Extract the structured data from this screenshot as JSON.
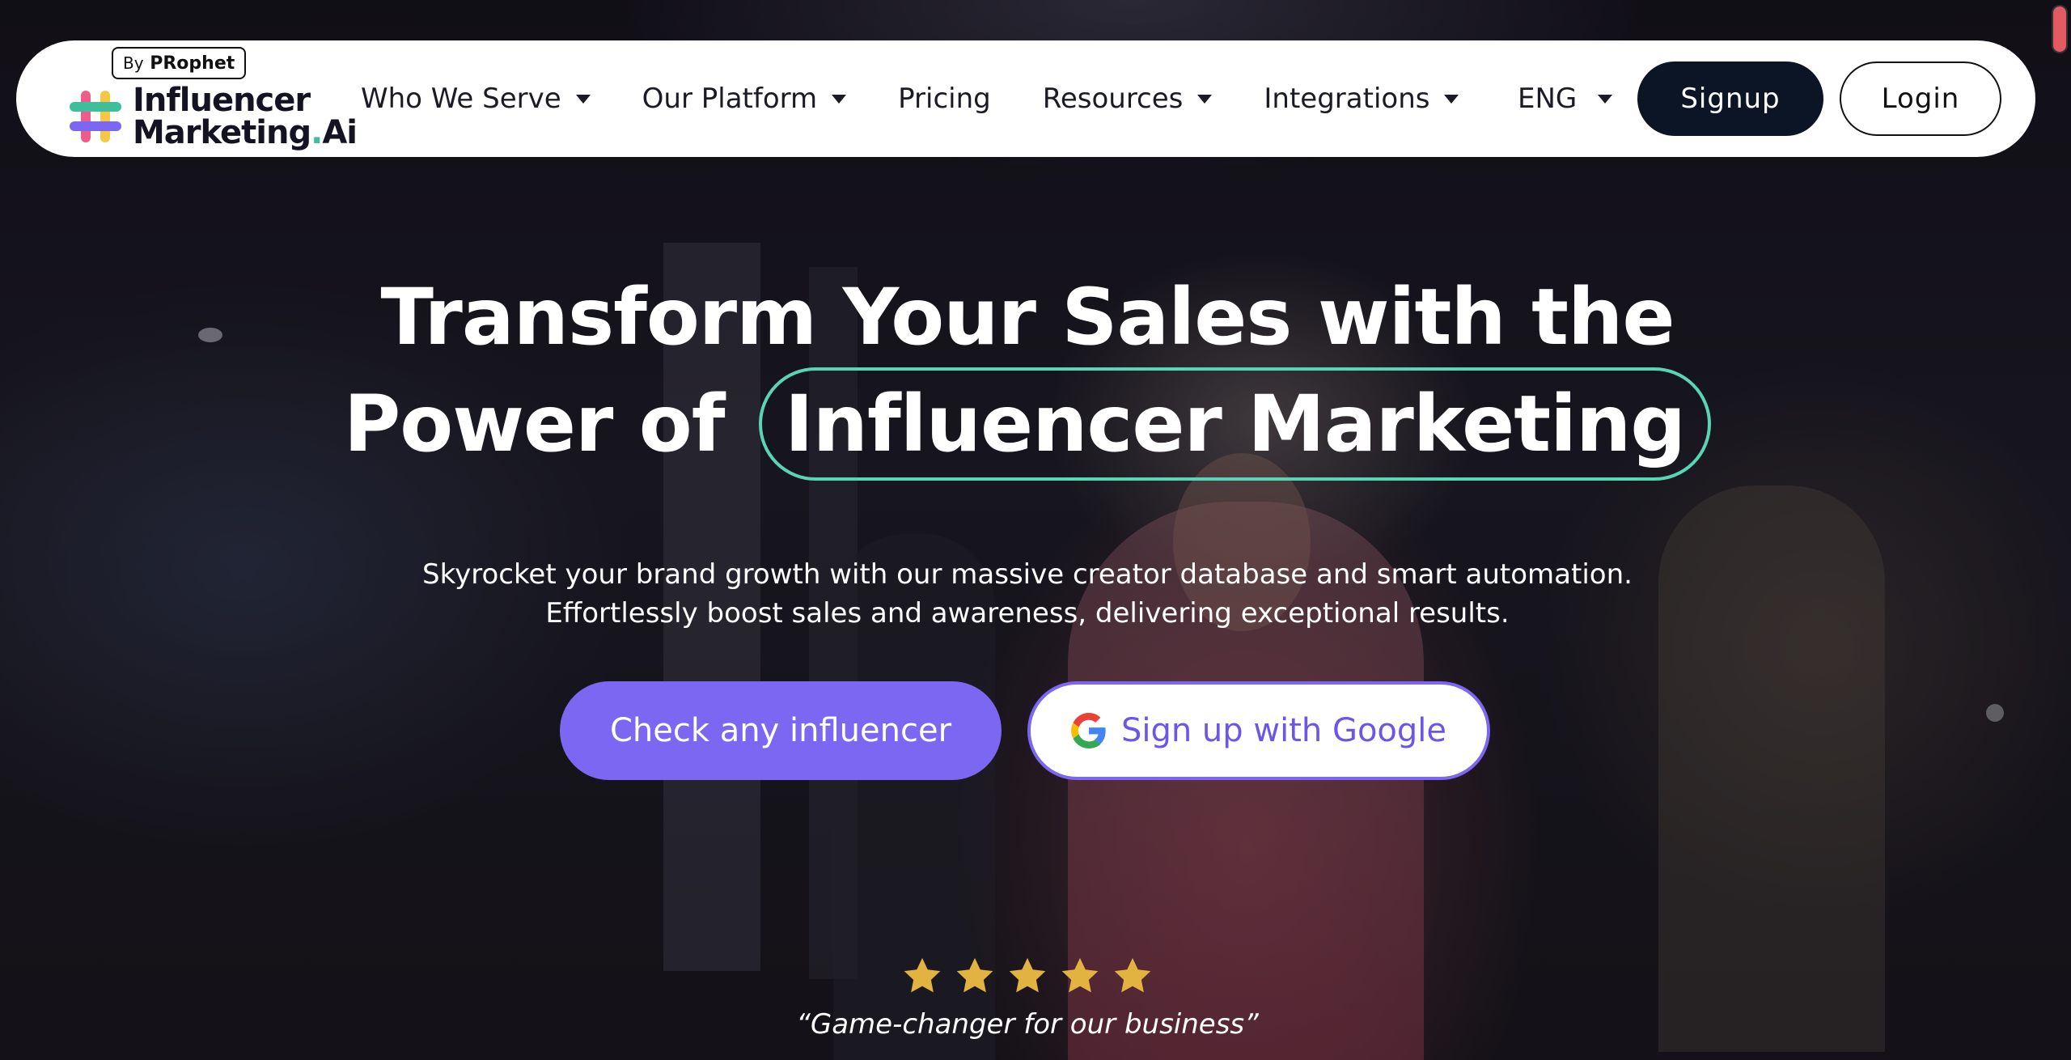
{
  "brand": {
    "badge_by": "By",
    "badge_name": "PRophet",
    "name_line1": "Influencer",
    "name_line2_main": "Marketing",
    "name_line2_dot": ".",
    "name_line2_end": "Ai"
  },
  "nav": {
    "items": [
      {
        "label": "Who We Serve",
        "has_dropdown": true
      },
      {
        "label": "Our Platform",
        "has_dropdown": true
      },
      {
        "label": "Pricing",
        "has_dropdown": false
      },
      {
        "label": "Resources",
        "has_dropdown": true
      },
      {
        "label": "Integrations",
        "has_dropdown": true
      }
    ],
    "language": "ENG",
    "signup_label": "Signup",
    "login_label": "Login"
  },
  "hero": {
    "headline_line1": "Transform Your Sales with the",
    "headline_line2_prefix": "Power of",
    "headline_highlight": "Influencer Marketing",
    "subhead_line1": "Skyrocket your brand growth with our massive creator database and smart automation.",
    "subhead_line2": "Effortlessly boost sales and awareness, delivering exceptional results.",
    "cta_primary": "Check any influencer",
    "cta_google": "Sign up with Google",
    "rating_stars": 5,
    "testimonial": "“Game-changer for our business”"
  },
  "colors": {
    "accent_purple": "#7b67f2",
    "accent_teal": "#59d4b5",
    "navy": "#0b1526",
    "star_gold": "#e3b341"
  },
  "icons": [
    "logo-hash-icon",
    "chevron-down-icon",
    "google-icon",
    "star-icon"
  ]
}
